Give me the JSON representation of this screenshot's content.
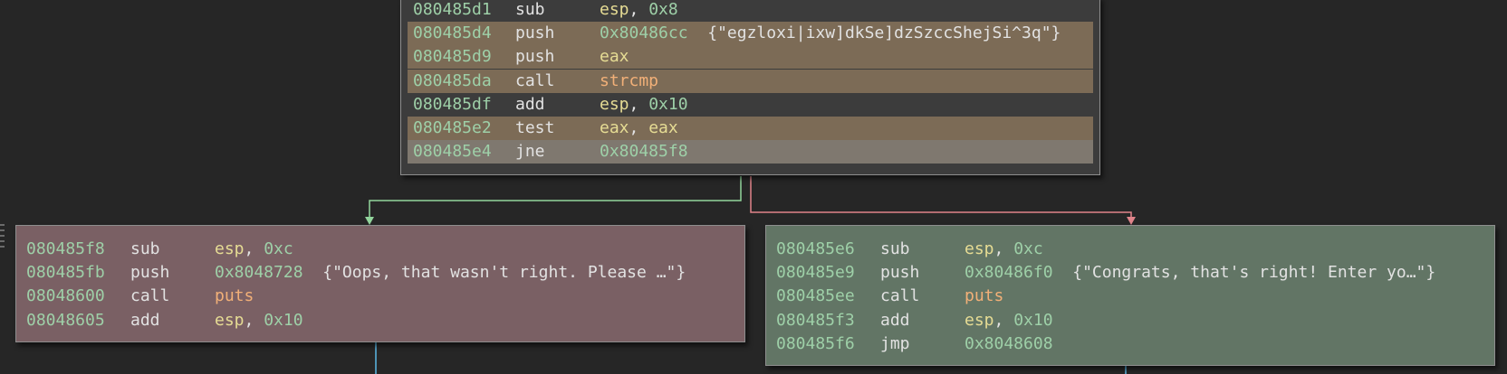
{
  "colors": {
    "background": "#262626",
    "top_block_bg": "#3c3c3c",
    "highlight_row": "#7c6b56",
    "selected_row": "#7f786f",
    "fail_block_bg": "#7a6064",
    "success_block_bg": "#627565",
    "true_edge": "#92d59c",
    "false_edge": "#e0848a",
    "exit_edge": "#5cb8e6"
  },
  "top_block": {
    "rows": [
      {
        "addr": "080485d1",
        "mnemonic": "sub",
        "ops": [
          {
            "t": "esp",
            "k": "reg"
          },
          {
            "t": ", ",
            "k": "plain"
          },
          {
            "t": "0x8",
            "k": "num"
          }
        ]
      },
      {
        "addr": "080485d4",
        "mnemonic": "push",
        "ops": [
          {
            "t": "0x80486cc",
            "k": "num"
          },
          {
            "t": "  ",
            "k": "plain"
          },
          {
            "t": "{\"egzloxi|ixw]dkSe]dzSzccShejSi^3q\"}",
            "k": "str"
          }
        ]
      },
      {
        "addr": "080485d9",
        "mnemonic": "push",
        "ops": [
          {
            "t": "eax",
            "k": "reg"
          }
        ]
      },
      {
        "addr": "080485da",
        "mnemonic": "call",
        "ops": [
          {
            "t": "strcmp",
            "k": "fn"
          }
        ]
      },
      {
        "addr": "080485df",
        "mnemonic": "add",
        "ops": [
          {
            "t": "esp",
            "k": "reg"
          },
          {
            "t": ", ",
            "k": "plain"
          },
          {
            "t": "0x10",
            "k": "num"
          }
        ]
      },
      {
        "addr": "080485e2",
        "mnemonic": "test",
        "ops": [
          {
            "t": "eax",
            "k": "reg"
          },
          {
            "t": ", ",
            "k": "plain"
          },
          {
            "t": "eax",
            "k": "reg"
          }
        ]
      },
      {
        "addr": "080485e4",
        "mnemonic": "jne",
        "ops": [
          {
            "t": "0x80485f8",
            "k": "num"
          }
        ]
      }
    ]
  },
  "fail_block": {
    "rows": [
      {
        "addr": "080485f8",
        "mnemonic": "sub",
        "ops": [
          {
            "t": "esp",
            "k": "reg"
          },
          {
            "t": ", ",
            "k": "plain"
          },
          {
            "t": "0xc",
            "k": "num"
          }
        ]
      },
      {
        "addr": "080485fb",
        "mnemonic": "push",
        "ops": [
          {
            "t": "0x8048728",
            "k": "num"
          },
          {
            "t": "  ",
            "k": "plain"
          },
          {
            "t": "{\"Oops, that wasn't right. Please …\"}",
            "k": "str"
          }
        ]
      },
      {
        "addr": "08048600",
        "mnemonic": "call",
        "ops": [
          {
            "t": "puts",
            "k": "fn"
          }
        ]
      },
      {
        "addr": "08048605",
        "mnemonic": "add",
        "ops": [
          {
            "t": "esp",
            "k": "reg"
          },
          {
            "t": ", ",
            "k": "plain"
          },
          {
            "t": "0x10",
            "k": "num"
          }
        ]
      }
    ]
  },
  "success_block": {
    "rows": [
      {
        "addr": "080485e6",
        "mnemonic": "sub",
        "ops": [
          {
            "t": "esp",
            "k": "reg"
          },
          {
            "t": ", ",
            "k": "plain"
          },
          {
            "t": "0xc",
            "k": "num"
          }
        ]
      },
      {
        "addr": "080485e9",
        "mnemonic": "push",
        "ops": [
          {
            "t": "0x80486f0",
            "k": "num"
          },
          {
            "t": "  ",
            "k": "plain"
          },
          {
            "t": "{\"Congrats, that's right! Enter yo…\"}",
            "k": "str"
          }
        ]
      },
      {
        "addr": "080485ee",
        "mnemonic": "call",
        "ops": [
          {
            "t": "puts",
            "k": "fn"
          }
        ]
      },
      {
        "addr": "080485f3",
        "mnemonic": "add",
        "ops": [
          {
            "t": "esp",
            "k": "reg"
          },
          {
            "t": ", ",
            "k": "plain"
          },
          {
            "t": "0x10",
            "k": "num"
          }
        ]
      },
      {
        "addr": "080485f6",
        "mnemonic": "jmp",
        "ops": [
          {
            "t": "0x8048608",
            "k": "num"
          }
        ]
      }
    ]
  }
}
